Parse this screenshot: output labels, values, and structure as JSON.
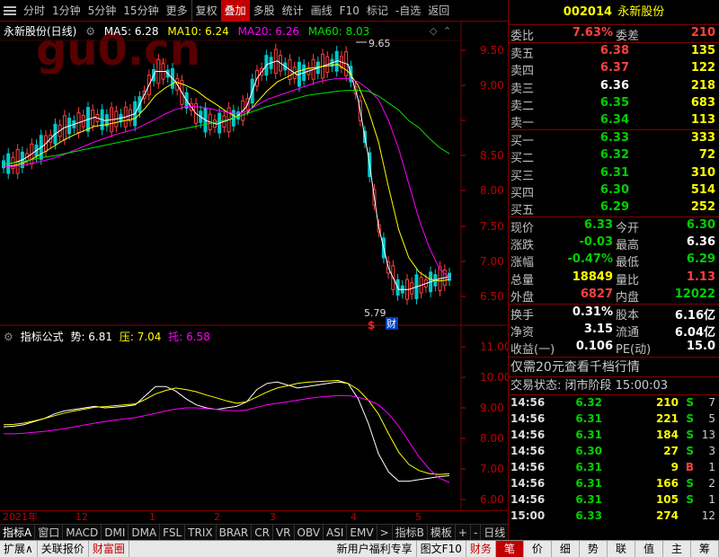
{
  "toolbar": {
    "items": [
      "分时",
      "1分钟",
      "5分钟",
      "15分钟",
      "更多",
      "复权",
      "叠加",
      "多股",
      "统计",
      "画线",
      "F10",
      "标记",
      "-自选",
      "返回"
    ],
    "active_index": 6
  },
  "chart": {
    "stock_label": "永新股份(日线)",
    "ma5": "MA5: 6.28",
    "ma10": "MA10: 6.24",
    "ma20": "MA20: 6.26",
    "ma60": "MA60: 8.03",
    "high_marker": "9.65",
    "low_marker": "5.79",
    "event_dollar": "$",
    "event_cai": "财",
    "price_ticks": [
      "9.50",
      "9.00",
      "8.50",
      "8.00",
      "7.50",
      "7.00",
      "6.50",
      "6.00"
    ],
    "indicator_name": "指标公式",
    "ind_shi": "势: 6.81",
    "ind_ya": "压: 7.04",
    "ind_tuo": "托: 6.58",
    "ind_ticks": [
      "11.00",
      "10.00",
      "9.00",
      "8.00",
      "7.00",
      "6.00"
    ],
    "watermark": "gu0.cn"
  },
  "chart_data": {
    "type": "line",
    "series": [
      {
        "name": "MA5",
        "values": [
          7.88,
          7.9,
          7.95,
          8.05,
          8.15,
          8.3,
          8.4,
          8.45,
          8.5,
          8.55,
          8.5,
          8.52,
          8.55,
          8.6,
          8.9,
          9.2,
          9.2,
          9.05,
          8.8,
          8.6,
          8.5,
          8.45,
          8.5,
          8.55,
          8.7,
          9.1,
          9.3,
          9.35,
          9.25,
          9.15,
          9.2,
          9.25,
          9.3,
          9.35,
          9.3,
          8.8,
          8.0,
          7.0,
          6.4,
          6.1,
          6.1,
          6.15,
          6.2,
          6.25,
          6.28
        ]
      },
      {
        "name": "MA10",
        "values": [
          7.85,
          7.86,
          7.9,
          7.97,
          8.05,
          8.14,
          8.23,
          8.3,
          8.36,
          8.42,
          8.44,
          8.47,
          8.5,
          8.53,
          8.68,
          8.86,
          8.97,
          9.05,
          9.0,
          8.93,
          8.82,
          8.73,
          8.63,
          8.55,
          8.6,
          8.76,
          8.92,
          9.05,
          9.12,
          9.2,
          9.24,
          9.26,
          9.28,
          9.3,
          9.2,
          9.0,
          8.65,
          8.2,
          7.55,
          6.95,
          6.55,
          6.35,
          6.25,
          6.22,
          6.24
        ]
      },
      {
        "name": "MA20",
        "values": [
          7.85,
          7.85,
          7.87,
          7.9,
          7.93,
          7.97,
          8.02,
          8.08,
          8.14,
          8.2,
          8.25,
          8.3,
          8.34,
          8.38,
          8.45,
          8.52,
          8.6,
          8.66,
          8.7,
          8.7,
          8.68,
          8.65,
          8.62,
          8.6,
          8.63,
          8.72,
          8.8,
          8.85,
          8.9,
          8.95,
          9.0,
          9.05,
          9.08,
          9.1,
          9.1,
          9.05,
          8.95,
          8.8,
          8.5,
          8.1,
          7.6,
          7.1,
          6.7,
          6.4,
          6.26
        ]
      },
      {
        "name": "MA60",
        "values": [
          7.88,
          7.9,
          7.92,
          7.95,
          7.98,
          8.0,
          8.03,
          8.06,
          8.09,
          8.12,
          8.15,
          8.18,
          8.21,
          8.24,
          8.27,
          8.3,
          8.33,
          8.36,
          8.39,
          8.42,
          8.45,
          8.48,
          8.51,
          8.55,
          8.6,
          8.65,
          8.7,
          8.74,
          8.78,
          8.82,
          8.86,
          8.88,
          8.9,
          8.92,
          8.93,
          8.93,
          8.92,
          8.85,
          8.75,
          8.65,
          8.5,
          8.4,
          8.25,
          8.12,
          8.03
        ]
      }
    ],
    "ylim": [
      5.7,
      9.95
    ]
  },
  "datebar": [
    "2021年",
    "12",
    "1",
    "2",
    "3",
    "4",
    "5"
  ],
  "tabs": [
    "指标A",
    "窗口",
    "MACD",
    "DMI",
    "DMA",
    "FSL",
    "TRIX",
    "BRAR",
    "CR",
    "VR",
    "OBV",
    "ASI",
    "EMV",
    "指标B",
    "模板",
    "+",
    "-",
    "日线"
  ],
  "statusbar": {
    "left": [
      "扩展∧",
      "关联报价",
      "财富圈"
    ],
    "mid": [
      "新用户福利专享",
      "图文F10",
      "财务"
    ],
    "right_tabs": [
      "笔",
      "价",
      "细",
      "势",
      "联",
      "值",
      "主",
      "筹"
    ]
  },
  "quote": {
    "code": "002014",
    "name": "永新股份",
    "weibi_label": "委比",
    "weibi": "7.63%",
    "weicha_label": "委差",
    "weicha": "210",
    "asks": [
      {
        "label": "卖五",
        "price": "6.38",
        "vol": "135"
      },
      {
        "label": "卖四",
        "price": "6.37",
        "vol": "122"
      },
      {
        "label": "卖三",
        "price": "6.36",
        "vol": "218"
      },
      {
        "label": "卖二",
        "price": "6.35",
        "vol": "683"
      },
      {
        "label": "卖一",
        "price": "6.34",
        "vol": "113"
      }
    ],
    "bids": [
      {
        "label": "买一",
        "price": "6.33",
        "vol": "333"
      },
      {
        "label": "买二",
        "price": "6.32",
        "vol": "72"
      },
      {
        "label": "买三",
        "price": "6.31",
        "vol": "310"
      },
      {
        "label": "买四",
        "price": "6.30",
        "vol": "514"
      },
      {
        "label": "买五",
        "price": "6.29",
        "vol": "252"
      }
    ],
    "stats": [
      {
        "l1": "现价",
        "v1": "6.33",
        "l2": "今开",
        "v2": "6.30"
      },
      {
        "l1": "涨跌",
        "v1": "-0.03",
        "l2": "最高",
        "v2": "6.36"
      },
      {
        "l1": "涨幅",
        "v1": "-0.47%",
        "l2": "最低",
        "v2": "6.29"
      },
      {
        "l1": "总量",
        "v1": "18849",
        "l2": "量比",
        "v2": "1.13"
      },
      {
        "l1": "外盘",
        "v1": "6827",
        "l2": "内盘",
        "v2": "12022"
      }
    ],
    "fund": [
      {
        "l1": "换手",
        "v1": "0.31%",
        "l2": "股本",
        "v2": "6.16亿"
      },
      {
        "l1": "净资",
        "v1": "3.15",
        "l2": "流通",
        "v2": "6.04亿"
      },
      {
        "l1": "收益(一)",
        "v1": "0.106",
        "l2": "PE(动)",
        "v2": "15.0"
      }
    ],
    "promo": "仅需20元查看千档行情",
    "trade_state": "交易状态: 闭市阶段 15:00:03",
    "trades": [
      {
        "time": "14:56",
        "price": "6.32",
        "vol": "210",
        "dir": "S",
        "n": "7"
      },
      {
        "time": "14:56",
        "price": "6.31",
        "vol": "221",
        "dir": "S",
        "n": "5"
      },
      {
        "time": "14:56",
        "price": "6.31",
        "vol": "184",
        "dir": "S",
        "n": "13"
      },
      {
        "time": "14:56",
        "price": "6.30",
        "vol": "27",
        "dir": "S",
        "n": "3"
      },
      {
        "time": "14:56",
        "price": "6.31",
        "vol": "9",
        "dir": "B",
        "n": "1"
      },
      {
        "time": "14:56",
        "price": "6.31",
        "vol": "166",
        "dir": "S",
        "n": "2"
      },
      {
        "time": "14:56",
        "price": "6.31",
        "vol": "105",
        "dir": "S",
        "n": "1"
      },
      {
        "time": "15:00",
        "price": "6.33",
        "vol": "274",
        "dir": "",
        "n": "12"
      }
    ]
  }
}
